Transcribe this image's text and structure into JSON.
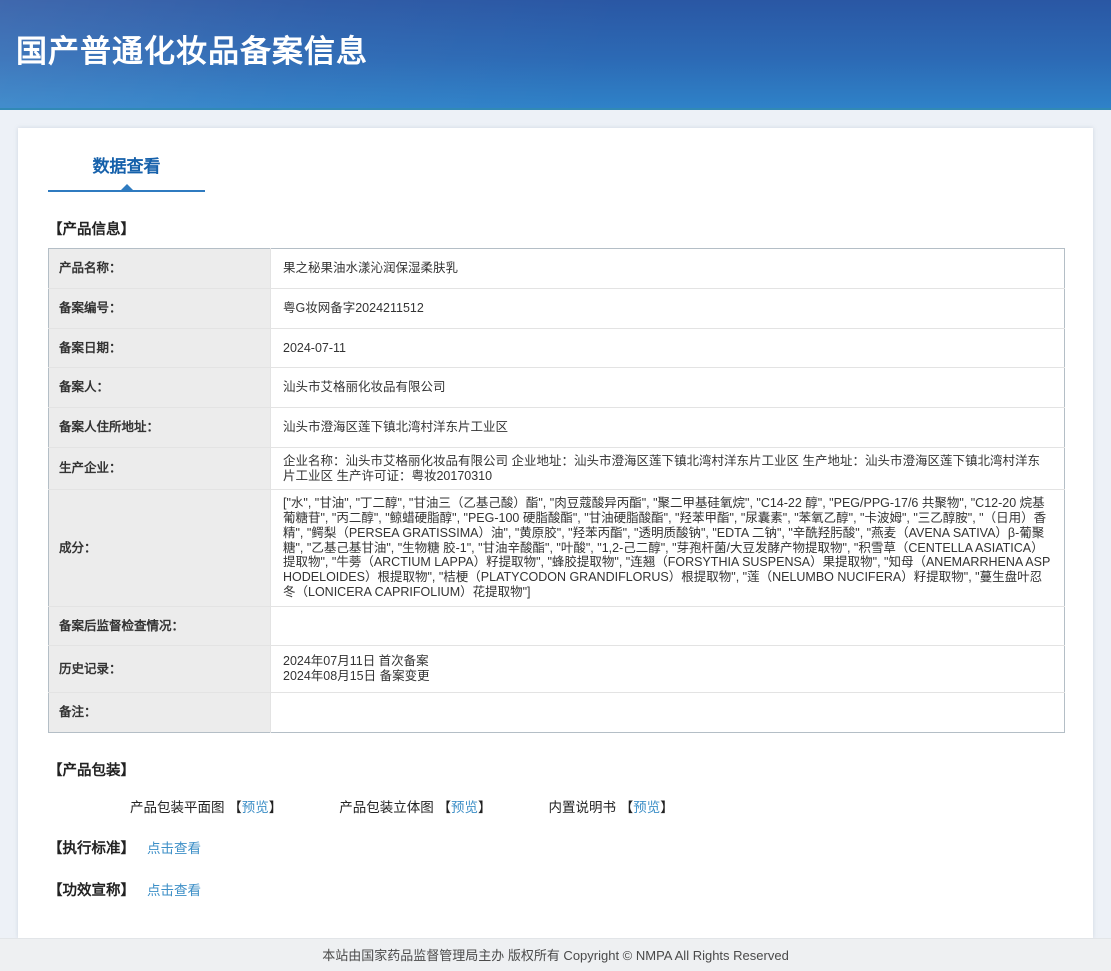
{
  "colors": {
    "header_blue_top": "#2a57a4",
    "header_blue_bottom": "#2f82c8",
    "tab_blue": "#1661ab",
    "underline_blue": "#2f7bc0",
    "link_blue": "#3d8fc7",
    "label_cell_bg": "#ececec"
  },
  "header": {
    "title": "国产普通化妆品备案信息"
  },
  "tabs": {
    "data_view": "数据查看"
  },
  "sections": {
    "product_info": "【产品信息】",
    "packaging": "【产品包装】",
    "standard": "【执行标准】",
    "efficacy": "【功效宣称】"
  },
  "product_table": {
    "rows": [
      {
        "label": "产品名称：",
        "value": "果之秘果油水漾沁润保湿柔肤乳"
      },
      {
        "label": "备案编号：",
        "value": "粤G妆网备字2024211512"
      },
      {
        "label": "备案日期：",
        "value": "2024-07-11"
      },
      {
        "label": "备案人：",
        "value": "汕头市艾格丽化妆品有限公司"
      },
      {
        "label": "备案人住所地址：",
        "value": "汕头市澄海区莲下镇北湾村洋东片工业区"
      },
      {
        "label": "生产企业：",
        "value": "企业名称：汕头市艾格丽化妆品有限公司 企业地址：汕头市澄海区莲下镇北湾村洋东片工业区 生产地址：汕头市澄海区莲下镇北湾村洋东片工业区 生产许可证：粤妆20170310"
      },
      {
        "label": "成分：",
        "value": "[\"水\", \"甘油\", \"丁二醇\", \"甘油三（乙基己酸）酯\", \"肉豆蔻酸异丙酯\", \"聚二甲基硅氧烷\", \"C14-22 醇\", \"PEG/PPG-17/6 共聚物\", \"C12-20 烷基葡糖苷\", \"丙二醇\", \"鲸蜡硬脂醇\", \"PEG-100 硬脂酸酯\", \"甘油硬脂酸酯\", \"羟苯甲酯\", \"尿囊素\", \"苯氧乙醇\", \"卡波姆\", \"三乙醇胺\", \"（日用）香精\", \"鳄梨（PERSEA GRATISSIMA）油\", \"黄原胶\", \"羟苯丙酯\", \"透明质酸钠\", \"EDTA 二钠\", \"辛酰羟肟酸\", \"燕麦（AVENA SATIVA）β-葡聚糖\", \"乙基己基甘油\", \"生物糖 胶-1\", \"甘油辛酸酯\", \"叶酸\", \"1,2-己二醇\", \"芽孢杆菌/大豆发酵产物提取物\", \"积雪草（CENTELLA ASIATICA）提取物\", \"牛蒡（ARCTIUM LAPPA）籽提取物\", \"蜂胶提取物\", \"连翘（FORSYTHIA SUSPENSA）果提取物\", \"知母（ANEMARRHENA ASPHODELOIDES）根提取物\", \"桔梗（PLATYCODON GRANDIFLORUS）根提取物\", \"莲（NELUMBO NUCIFERA）籽提取物\", \"蔓生盘叶忍冬（LONICERA CAPRIFOLIUM）花提取物\"]"
      },
      {
        "label": "备案后监督检查情况：",
        "value": ""
      },
      {
        "label": "历史记录：",
        "value": "2024年07月11日 首次备案\n2024年08月15日 备案变更"
      },
      {
        "label": "备注：",
        "value": ""
      }
    ]
  },
  "packaging": {
    "bracket_open": "【",
    "bracket_close": "】",
    "preview_label": "预览",
    "items": [
      {
        "name": "产品包装平面图"
      },
      {
        "name": "产品包装立体图"
      },
      {
        "name": "内置说明书"
      }
    ]
  },
  "links": {
    "click_to_view": "点击查看"
  },
  "footer": {
    "text": "本站由国家药品监督管理局主办 版权所有 Copyright © NMPA All Rights Reserved"
  }
}
